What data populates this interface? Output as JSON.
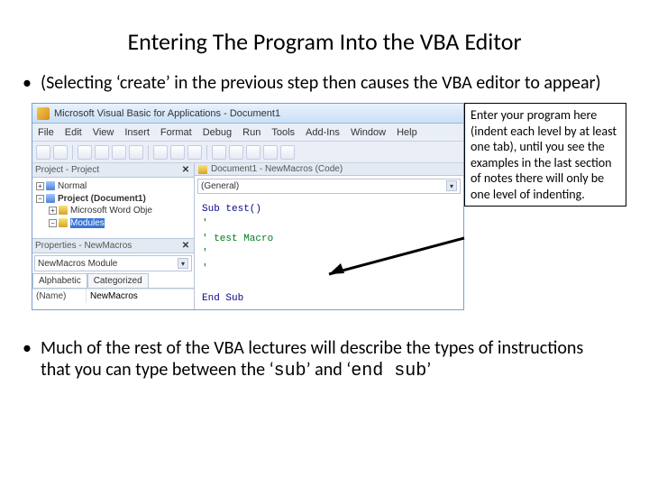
{
  "slide": {
    "title": "Entering The Program Into the VBA Editor",
    "bullet_top": "(Selecting ‘create’ in the previous step then causes the VBA editor to appear)",
    "bullet_bottom_pre": "Much of the rest of the VBA lectures will describe the types of instructions that you can type between the ‘",
    "bullet_bottom_mono1": "sub",
    "bullet_bottom_mid": "’ and ‘",
    "bullet_bottom_mono2": "end sub",
    "bullet_bottom_post": "’"
  },
  "annotation": "Enter your program here (indent each level by at least one tab), until you see the examples in the last section of notes there will only be one level of indenting.",
  "vba": {
    "title": "Microsoft Visual Basic for Applications - Document1",
    "menus": [
      "File",
      "Edit",
      "View",
      "Insert",
      "Format",
      "Debug",
      "Run",
      "Tools",
      "Add-Ins",
      "Window",
      "Help"
    ],
    "project_panel_title": "Project - Project",
    "tree": {
      "normal": "Normal",
      "project": "Project (Document1)",
      "wordobj": "Microsoft Word Obje",
      "modules": "Modules"
    },
    "props_panel_title": "Properties - NewMacros",
    "props_dropdown": "NewMacros Module",
    "props_tabs": {
      "alpha": "Alphabetic",
      "cat": "Categorized"
    },
    "props_name_label": "(Name)",
    "props_name_value": "NewMacros",
    "code_window_title": "Document1 - NewMacros (Code)",
    "code_dropdown": "(General)",
    "code": {
      "l1": "Sub test()",
      "l2": "'",
      "l3": "' test Macro",
      "l4": "'",
      "l5": "'",
      "l6": "End Sub"
    }
  }
}
